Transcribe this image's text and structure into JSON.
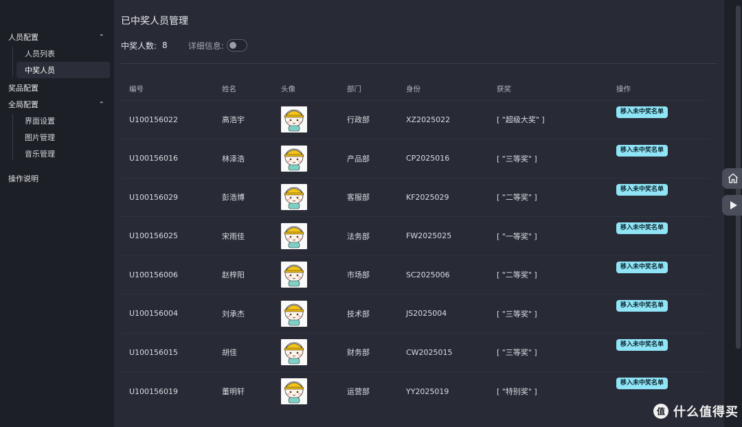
{
  "sidebar": {
    "groups": [
      {
        "title": "人员配置",
        "expanded": true,
        "items": [
          {
            "label": "人员列表",
            "active": false
          },
          {
            "label": "中奖人员",
            "active": true
          }
        ]
      },
      {
        "title": "奖品配置"
      },
      {
        "title": "全局配置",
        "expanded": true,
        "items": [
          {
            "label": "界面设置",
            "active": false
          },
          {
            "label": "图片管理",
            "active": false
          },
          {
            "label": "音乐管理",
            "active": false
          }
        ]
      },
      {
        "title": "操作说明"
      }
    ]
  },
  "page": {
    "title": "已中奖人员管理",
    "count_label": "中奖人数:",
    "count_value": "8",
    "detail_label": "详细信息:",
    "detail_toggle_on": false
  },
  "table": {
    "headers": [
      "编号",
      "姓名",
      "头像",
      "部门",
      "身份",
      "获奖",
      "操作"
    ],
    "action_label": "移入未中奖名单",
    "rows": [
      {
        "id": "U100156022",
        "name": "高浩宇",
        "dept": "行政部",
        "identity": "XZ2025022",
        "prize": "[ \"超级大奖\" ]"
      },
      {
        "id": "U100156016",
        "name": "林泽浩",
        "dept": "产品部",
        "identity": "CP2025016",
        "prize": "[ \"三等奖\" ]"
      },
      {
        "id": "U100156029",
        "name": "彭浩博",
        "dept": "客服部",
        "identity": "KF2025029",
        "prize": "[ \"二等奖\" ]"
      },
      {
        "id": "U100156025",
        "name": "宋雨佳",
        "dept": "法务部",
        "identity": "FW2025025",
        "prize": "[ \"一等奖\" ]"
      },
      {
        "id": "U100156006",
        "name": "赵梓阳",
        "dept": "市场部",
        "identity": "SC2025006",
        "prize": "[ \"二等奖\" ]"
      },
      {
        "id": "U100156004",
        "name": "刘承杰",
        "dept": "技术部",
        "identity": "JS2025004",
        "prize": "[ \"三等奖\" ]"
      },
      {
        "id": "U100156015",
        "name": "胡佳",
        "dept": "财务部",
        "identity": "CW2025015",
        "prize": "[ \"三等奖\" ]"
      },
      {
        "id": "U100156019",
        "name": "董明轩",
        "dept": "运营部",
        "identity": "YY2025019",
        "prize": "[ \"特别奖\" ]"
      }
    ]
  },
  "floating": {
    "home_icon": "home-icon",
    "play_icon": "play-icon"
  },
  "watermark": {
    "text": "什么值得买"
  },
  "colors": {
    "accent_button": "#8fe4f5",
    "main_bg": "#282a35",
    "sidebar_bg": "#1d1f26"
  }
}
